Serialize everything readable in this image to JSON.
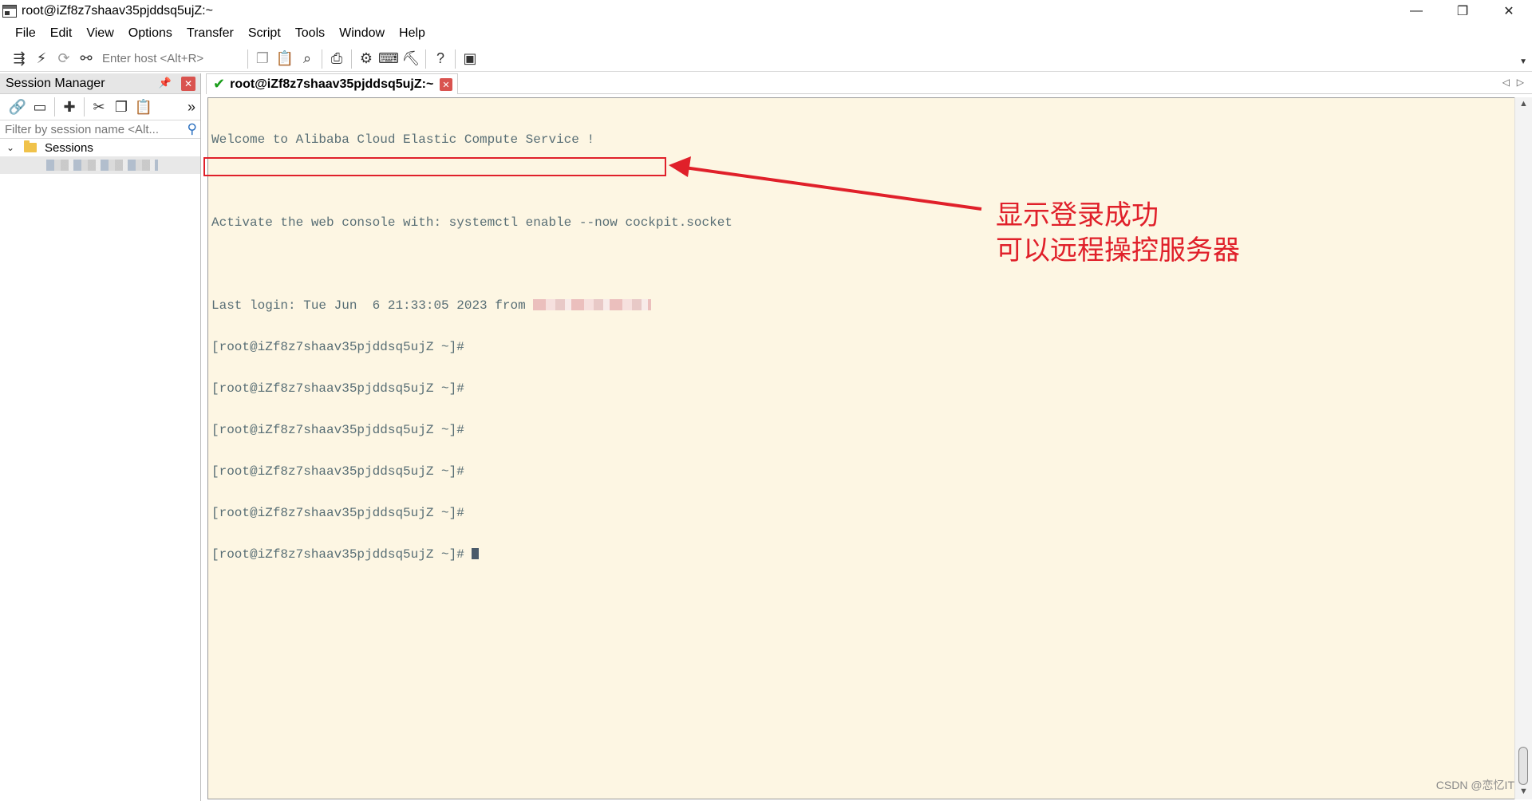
{
  "window": {
    "title": "root@iZf8z7shaav35pjddsq5ujZ:~",
    "controls": {
      "minimize": "—",
      "maximize": "❐",
      "close": "✕"
    }
  },
  "menu": [
    "File",
    "Edit",
    "View",
    "Options",
    "Transfer",
    "Script",
    "Tools",
    "Window",
    "Help"
  ],
  "toolbar": {
    "host_placeholder": "Enter host <Alt+R>",
    "icons": [
      "connect-icon",
      "quick-connect-icon",
      "reconnect-icon",
      "disconnect-icon",
      "copy-icon",
      "paste-icon",
      "find-icon",
      "print-icon",
      "settings-icon",
      "keymap-icon",
      "sftp-icon",
      "help-icon",
      "screen-icon"
    ]
  },
  "session_manager": {
    "title": "Session Manager",
    "filter_placeholder": "Filter by session name <Alt...",
    "tree_root": "Sessions"
  },
  "tab": {
    "label": "root@iZf8z7shaav35pjddsq5ujZ:~"
  },
  "terminal": {
    "welcome": "Welcome to Alibaba Cloud Elastic Compute Service !",
    "activate": "Activate the web console with: systemctl enable --now cockpit.socket",
    "last_login": "Last login: Tue Jun  6 21:33:05 2023 from ",
    "prompts": [
      "[root@iZf8z7shaav35pjddsq5ujZ ~]#",
      "[root@iZf8z7shaav35pjddsq5ujZ ~]#",
      "[root@iZf8z7shaav35pjddsq5ujZ ~]#",
      "[root@iZf8z7shaav35pjddsq5ujZ ~]#",
      "[root@iZf8z7shaav35pjddsq5ujZ ~]#"
    ],
    "current_prompt": "[root@iZf8z7shaav35pjddsq5ujZ ~]# "
  },
  "annotation": {
    "line1": "显示登录成功",
    "line2": "可以远程操控服务器",
    "color": "#e0202a"
  },
  "watermark": "CSDN @恋忆IT"
}
